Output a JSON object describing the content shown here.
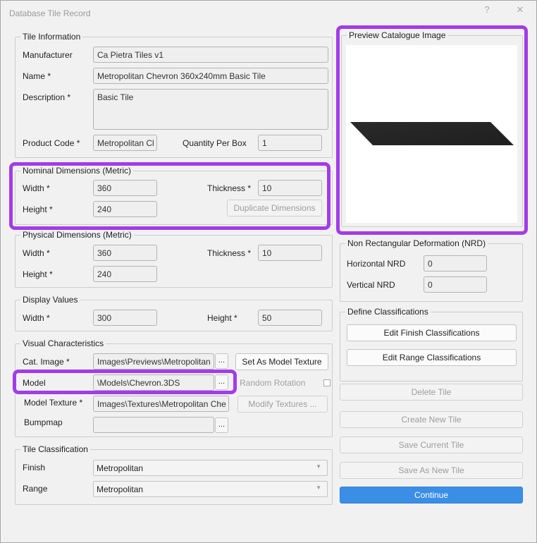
{
  "window": {
    "title": "Database Tile Record",
    "help": "?",
    "close": "✕"
  },
  "tile_information": {
    "legend": "Tile Information",
    "manufacturer_label": "Manufacturer",
    "manufacturer_value": "Ca Pietra Tiles v1",
    "name_label": "Name *",
    "name_value": "Metropolitan Chevron 360x240mm Basic Tile",
    "description_label": "Description *",
    "description_value": "Basic Tile",
    "product_code_label": "Product Code *",
    "product_code_value": "Metropolitan Cl",
    "quantity_label": "Quantity Per Box",
    "quantity_value": "1"
  },
  "nominal": {
    "legend": "Nominal Dimensions (Metric)",
    "width_label": "Width *",
    "width_value": "360",
    "thickness_label": "Thickness *",
    "thickness_value": "10",
    "height_label": "Height *",
    "height_value": "240",
    "duplicate_label": "Duplicate Dimensions"
  },
  "physical": {
    "legend": "Physical Dimensions (Metric)",
    "width_label": "Width *",
    "width_value": "360",
    "thickness_label": "Thickness *",
    "thickness_value": "10",
    "height_label": "Height *",
    "height_value": "240"
  },
  "display": {
    "legend": "Display Values",
    "width_label": "Width *",
    "width_value": "300",
    "height_label": "Height *",
    "height_value": "50"
  },
  "visual": {
    "legend": "Visual Characteristics",
    "cat_image_label": "Cat. Image *",
    "cat_image_value": "Images\\Previews\\Metropolitan",
    "set_texture_label": "Set As Model Texture",
    "model_label": "Model",
    "model_value": "\\Models\\Chevron.3DS",
    "random_rotation_label": "Random Rotation",
    "model_texture_label": "Model Texture *",
    "model_texture_value": "Images\\Textures\\Metropolitan Che",
    "modify_textures_label": "Modify Textures ...",
    "bumpmap_label": "Bumpmap",
    "bumpmap_value": "",
    "browse": "..."
  },
  "classification": {
    "legend": "Tile Classification",
    "finish_label": "Finish",
    "finish_value": "Metropolitan",
    "range_label": "Range",
    "range_value": "Metropolitan",
    "arrow": "▼"
  },
  "preview": {
    "legend": "Preview Catalogue Image"
  },
  "nrd": {
    "legend": "Non Rectangular Deformation (NRD)",
    "horizontal_label": "Horizontal NRD",
    "horizontal_value": "0",
    "vertical_label": "Vertical NRD",
    "vertical_value": "0"
  },
  "define": {
    "legend": "Define Classifications",
    "finish_btn": "Edit Finish Classifications",
    "range_btn": "Edit Range Classifications"
  },
  "actions": {
    "delete": "Delete Tile",
    "create": "Create New Tile",
    "save_current": "Save Current Tile",
    "save_new": "Save As New Tile",
    "continue": "Continue"
  },
  "colors": {
    "highlight": "#a23ce8",
    "primary": "#3b8ee6"
  }
}
